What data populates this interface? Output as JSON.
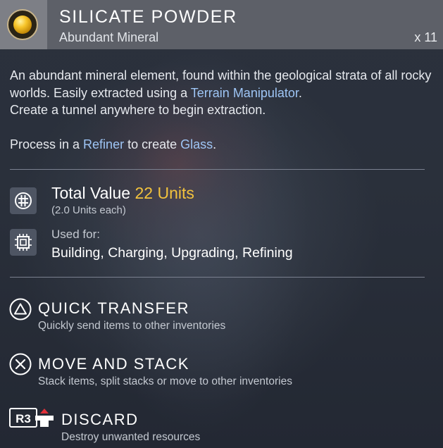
{
  "item": {
    "name": "SILICATE POWDER",
    "category": "Abundant Mineral",
    "quantity": "x 11",
    "icon": "golden-orb-icon",
    "description": {
      "p1_a": "An abundant mineral element, found within the geological strata of all rocky worlds. Easily extracted using a ",
      "p1_link": "Terrain Manipulator",
      "p1_b": ".",
      "p1_c": "Create a tunnel anywhere to begin extraction.",
      "p2_a": "Process in a ",
      "p2_link1": "Refiner",
      "p2_b": " to create ",
      "p2_link2": "Glass",
      "p2_c": "."
    }
  },
  "stats": {
    "total_label": "Total Value",
    "total_value": "22 Units",
    "unit_each": "(2.0 Units each)",
    "used_for_label": "Used for:",
    "used_for_value": "Building, Charging, Upgrading, Refining"
  },
  "actions": [
    {
      "button": "triangle-button-icon",
      "title": "QUICK TRANSFER",
      "desc": "Quickly send items to other inventories"
    },
    {
      "button": "cross-button-icon",
      "title": "MOVE AND STACK",
      "desc": "Stack items, split stacks or move to other inventories"
    },
    {
      "button": "r3-button-icon",
      "button_label": "R3",
      "title": "DISCARD",
      "desc": "Destroy unwanted resources"
    }
  ],
  "colors": {
    "header_bg": "#5d6068",
    "header_icon_bg": "#7d7f86",
    "link": "#9ec5f5",
    "value_gold": "#f2c23d",
    "discard_accent": "#e0313a",
    "panel_bg": "#2a303b"
  }
}
